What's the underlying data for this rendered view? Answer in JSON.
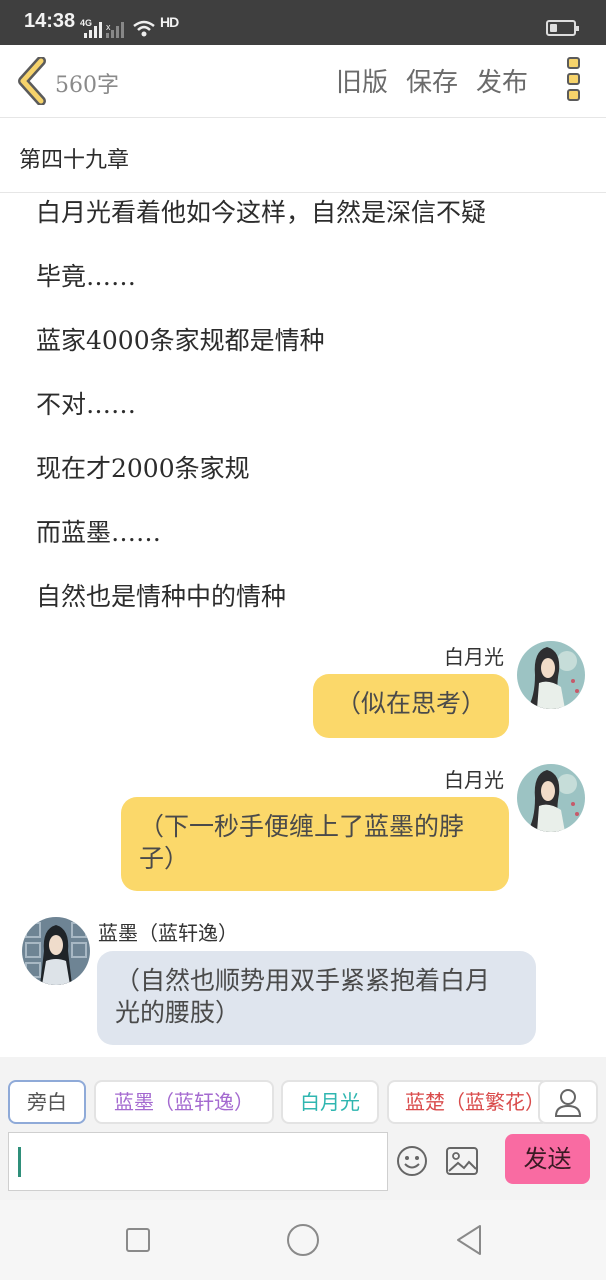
{
  "status_bar": {
    "time": "14:38",
    "network": "4G",
    "hd": "HD",
    "battery_level": 0.3
  },
  "header": {
    "back_icon": "chevron-left-icon",
    "word_count": "560字",
    "old_version": "旧版",
    "save": "保存",
    "publish": "发布",
    "more_icon": "more-vertical-icon"
  },
  "chapter": {
    "title": "第四十九章"
  },
  "narration": [
    "白月光看着他如今这样，自然是深信不疑",
    "毕竟……",
    "蓝家4000条家规都是情种",
    "不对……",
    "现在才2000条家规",
    "而蓝墨……",
    "自然也是情种中的情种"
  ],
  "messages": [
    {
      "speaker": "白月光",
      "side": "right",
      "text": "（似在思考）"
    },
    {
      "speaker": "白月光",
      "side": "right",
      "text_lines": [
        "（下一秒手便缠上了蓝墨的脖",
        "子）"
      ]
    },
    {
      "speaker": "蓝墨（蓝轩逸）",
      "side": "left",
      "text_lines": [
        "（自然也顺势用双手紧紧抱着白月",
        "光的腰肢）"
      ]
    }
  ],
  "roles": [
    {
      "label": "旁白",
      "color": "#555555",
      "active": true
    },
    {
      "label": "蓝墨（蓝轩逸）",
      "color": "#a46ad0",
      "active": false
    },
    {
      "label": "白月光",
      "color": "#2fb6b0",
      "active": false
    },
    {
      "label": "蓝楚（蓝繁花）",
      "color": "#d94b4b",
      "active": false
    }
  ],
  "composer": {
    "input_value": "",
    "send_label": "发送",
    "emoji_icon": "smiley-icon",
    "image_icon": "image-icon",
    "person_icon": "person-icon"
  },
  "colors": {
    "status_bar": "#3f3f3f",
    "bubble_right": "#fbd86a",
    "bubble_left": "#dfe5ee",
    "send_button": "#f96ba2"
  }
}
